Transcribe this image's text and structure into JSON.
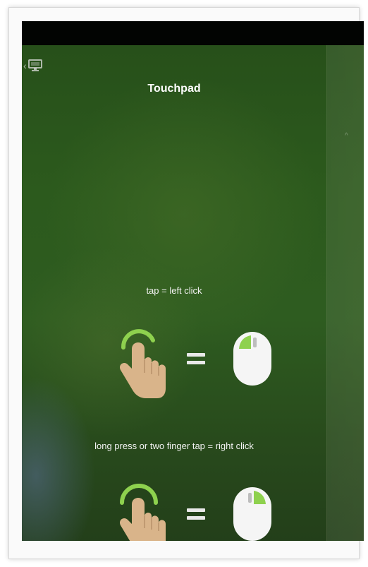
{
  "screen": {
    "title": "Touchpad",
    "back_icon": "chevron-left-icon",
    "device_icon": "monitor-icon"
  },
  "instructions": [
    {
      "caption": "tap = left click",
      "gesture_icon": "one-finger-tap-icon",
      "equals": "=",
      "mouse_icon": "mouse-left-button-icon"
    },
    {
      "caption": "long press or two finger tap = right click",
      "gesture_icon": "finger-long-press-icon",
      "equals": "=",
      "mouse_icon": "mouse-right-button-icon"
    }
  ],
  "colors": {
    "background": "#2c5a1d",
    "accent_green": "#8ed14e",
    "hand_skin": "#d9b48a",
    "mouse_body": "#f5f5f5"
  }
}
